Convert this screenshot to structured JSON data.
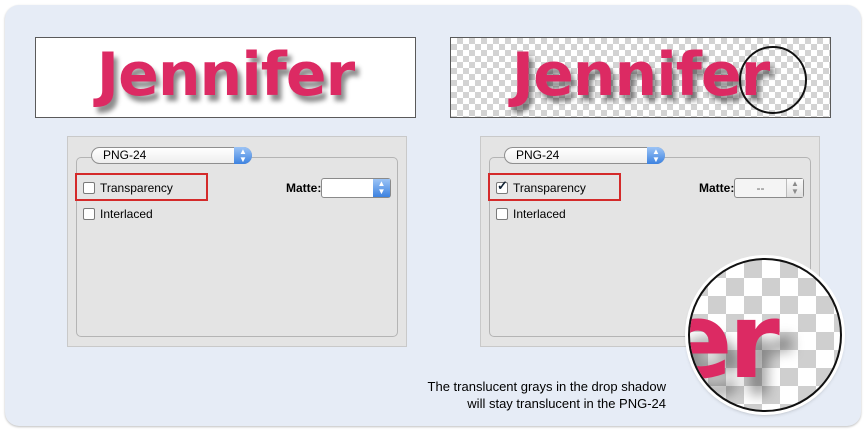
{
  "previews": {
    "left": {
      "text": "Jennifer",
      "background": "white"
    },
    "right": {
      "text": "Jennifer",
      "background": "transparent-checkerboard"
    }
  },
  "panels": {
    "left": {
      "format": "PNG-24",
      "transparency_label": "Transparency",
      "transparency_checked": false,
      "interlaced_label": "Interlaced",
      "interlaced_checked": false,
      "matte_label": "Matte:",
      "matte_value": ""
    },
    "right": {
      "format": "PNG-24",
      "transparency_label": "Transparency",
      "transparency_checked": true,
      "interlaced_label": "Interlaced",
      "interlaced_checked": false,
      "matte_label": "Matte:",
      "matte_value": "--"
    }
  },
  "zoom": {
    "text": "er"
  },
  "caption": {
    "line1": "The translucent grays in the drop shadow",
    "line2": "will stay translucent in the PNG-24"
  },
  "colors": {
    "accent": "#dc2a63",
    "highlight": "#d42a2a",
    "frame_bg": "#e6ecf6"
  }
}
